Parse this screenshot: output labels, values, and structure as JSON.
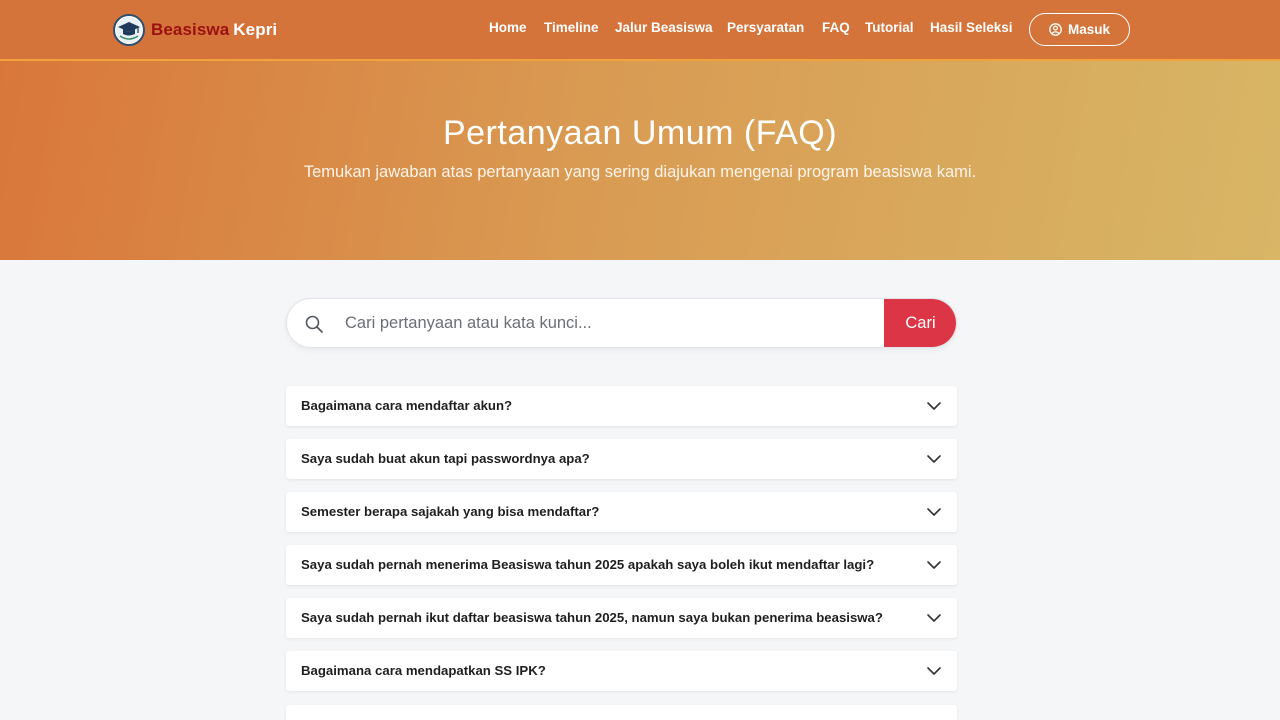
{
  "brand": {
    "part1": "Beasiswa",
    "part2": "Kepri",
    "logo_icon": "graduation-cap-logo"
  },
  "nav": {
    "items": [
      {
        "label": "Home"
      },
      {
        "label": "Timeline"
      },
      {
        "label": "Jalur Beasiswa"
      },
      {
        "label": "Persyaratan"
      },
      {
        "label": "FAQ"
      },
      {
        "label": "Tutorial"
      },
      {
        "label": "Hasil Seleksi"
      }
    ],
    "login_label": "Masuk",
    "login_icon": "user-circle-icon"
  },
  "hero": {
    "title": "Pertanyaan Umum (FAQ)",
    "subtitle": "Temukan jawaban atas pertanyaan yang sering diajukan mengenai program beasiswa kami."
  },
  "search": {
    "placeholder": "Cari pertanyaan atau kata kunci...",
    "button_label": "Cari",
    "icon": "search-icon"
  },
  "faq": {
    "items": [
      {
        "question": "Bagaimana cara mendaftar akun?"
      },
      {
        "question": "Saya sudah buat akun tapi passwordnya apa?"
      },
      {
        "question": "Semester berapa sajakah yang bisa mendaftar?"
      },
      {
        "question": "Saya sudah pernah menerima Beasiswa tahun 2025 apakah saya boleh ikut mendaftar lagi?"
      },
      {
        "question": "Saya sudah pernah ikut daftar beasiswa tahun 2025, namun saya bukan penerima beasiswa?"
      },
      {
        "question": "Bagaimana cara mendapatkan SS IPK?"
      }
    ]
  },
  "colors": {
    "navbar": "#d5743a",
    "navbar_border": "#f2a23a",
    "hero_start": "#d9773a",
    "hero_end": "#d8b666",
    "accent_button": "#dc3545",
    "brand_dark_red": "#9c1010",
    "page_bg": "#f5f6f8"
  }
}
